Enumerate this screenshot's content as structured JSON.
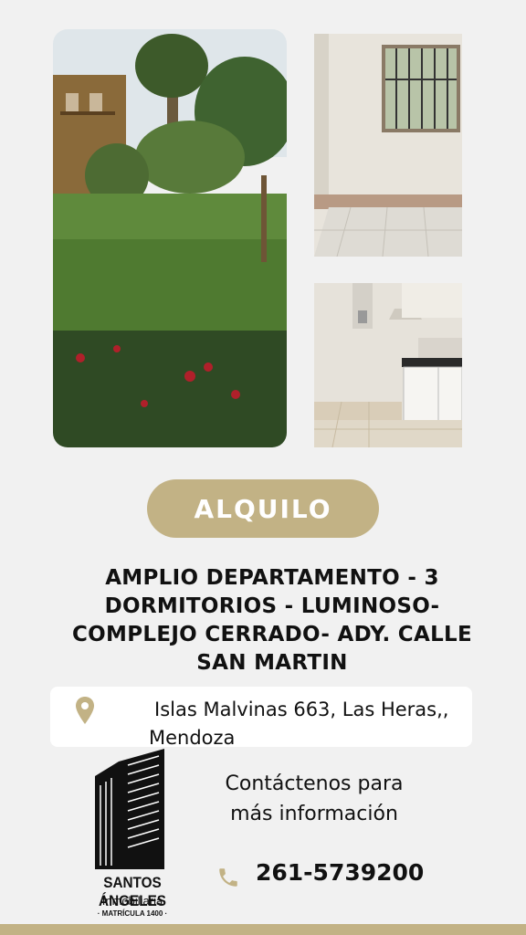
{
  "colors": {
    "accent": "#c2b285",
    "background": "#f1f1f1",
    "text": "#111111"
  },
  "badge": {
    "label": "ALQUILO"
  },
  "headline": {
    "text": "AMPLIO DEPARTAMENTO - 3 DORMITORIOS - LUMINOSO- COMPLEJO CERRADO- ADY. CALLE SAN MARTIN"
  },
  "address": {
    "icon": "map-pin-icon",
    "text": "Islas Malvinas 663,  Las Heras,, Mendoza"
  },
  "brand": {
    "name": "SANTOS ÁNGELES",
    "subtitle": "Inmobiliaria",
    "license": "· MATRÍCULA 1400 ·"
  },
  "contact": {
    "line1": "Contáctenos para",
    "line2": "más información",
    "phone_icon": "phone-icon",
    "phone": "261-5739200"
  }
}
